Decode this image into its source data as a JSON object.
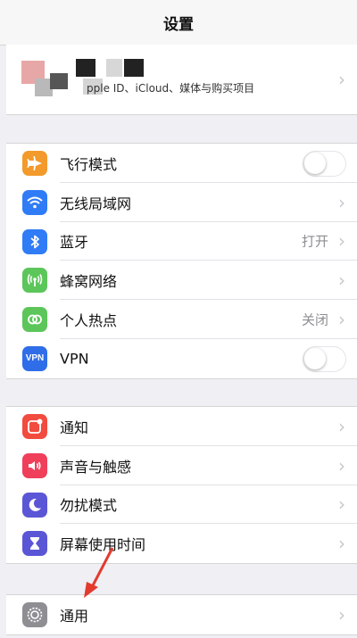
{
  "nav": {
    "title": "设置"
  },
  "profile": {
    "subtitle": "pple ID、iCloud、媒体与购买项目"
  },
  "group1": [
    {
      "key": "airplane",
      "label": "飞行模式",
      "icon": "airplane-icon",
      "color": "#f39a2c",
      "control": "toggle",
      "on": false
    },
    {
      "key": "wifi",
      "label": "无线局域网",
      "icon": "wifi-icon",
      "color": "#2f7cf6",
      "control": "chevron",
      "value": ""
    },
    {
      "key": "bluetooth",
      "label": "蓝牙",
      "icon": "bluetooth-icon",
      "color": "#2f7cf6",
      "control": "chevron",
      "value": "打开"
    },
    {
      "key": "cellular",
      "label": "蜂窝网络",
      "icon": "cellular-icon",
      "color": "#5cc65a",
      "control": "chevron",
      "value": ""
    },
    {
      "key": "hotspot",
      "label": "个人热点",
      "icon": "hotspot-icon",
      "color": "#5cc65a",
      "control": "chevron",
      "value": "关闭"
    },
    {
      "key": "vpn",
      "label": "VPN",
      "icon": "vpn-icon",
      "icon_text": "VPN",
      "color": "#2f6ee8",
      "control": "toggle",
      "on": false
    }
  ],
  "group2": [
    {
      "key": "notifications",
      "label": "通知",
      "icon": "notification-icon",
      "color": "#f24b3f",
      "control": "chevron"
    },
    {
      "key": "sounds",
      "label": "声音与触感",
      "icon": "speaker-icon",
      "color": "#ef3f5b",
      "control": "chevron"
    },
    {
      "key": "dnd",
      "label": "勿扰模式",
      "icon": "moon-icon",
      "color": "#5b56d6",
      "control": "chevron"
    },
    {
      "key": "screentime",
      "label": "屏幕使用时间",
      "icon": "hourglass-icon",
      "color": "#5b56d6",
      "control": "chevron"
    }
  ],
  "group3": [
    {
      "key": "general",
      "label": "通用",
      "icon": "gear-icon",
      "color": "#8e8e93",
      "control": "chevron"
    }
  ],
  "annotation": {
    "arrow_color": "#e23b2e"
  }
}
